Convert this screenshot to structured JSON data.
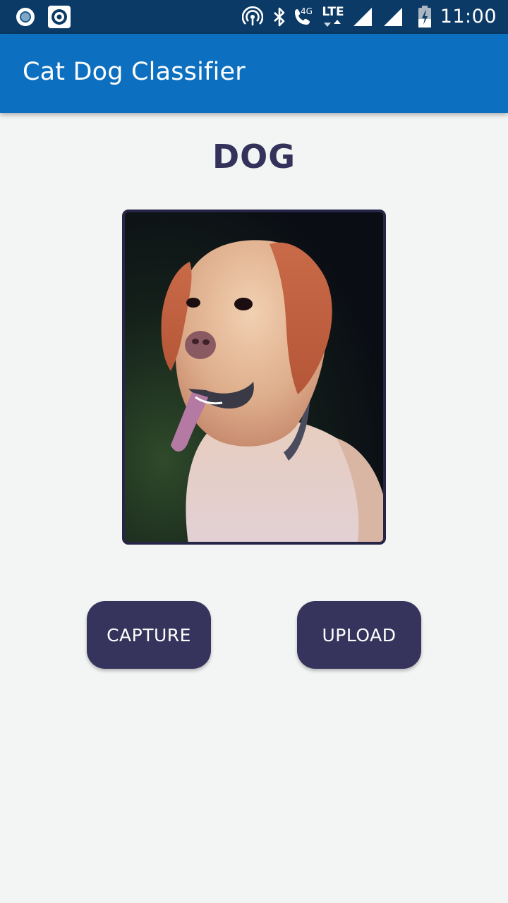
{
  "status_bar": {
    "time": "11:00",
    "network_type": "LTE",
    "call_network": "4G",
    "icons": [
      "notification-circle-icon",
      "notification-target-icon",
      "hotspot-icon",
      "bluetooth-icon",
      "wifi-call-icon",
      "lte-data-icon",
      "signal-icon",
      "signal-icon",
      "battery-charging-icon"
    ]
  },
  "app_bar": {
    "title": "Cat Dog Classifier"
  },
  "result": {
    "label": "DOG"
  },
  "image": {
    "subject": "dog-photo"
  },
  "buttons": {
    "capture_label": "CAPTURE",
    "upload_label": "UPLOAD"
  },
  "colors": {
    "status_bar_bg": "#0b3a66",
    "app_bar_bg": "#0c6fc0",
    "accent": "#36335c",
    "label_text": "#34315a",
    "page_bg": "#f3f4f4"
  }
}
